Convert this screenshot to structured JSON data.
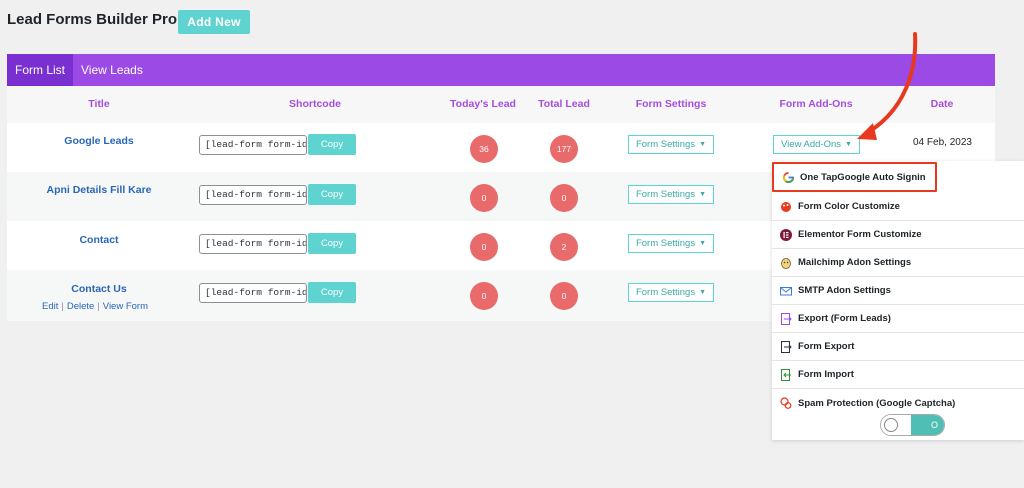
{
  "header": {
    "title": "Lead Forms Builder Pro",
    "add_new_label": "Add New"
  },
  "tabs": [
    {
      "label": "Form List",
      "active": true
    },
    {
      "label": "View Leads",
      "active": false
    }
  ],
  "columns": {
    "title": "Title",
    "shortcode": "Shortcode",
    "todays_lead": "Today's Lead",
    "total_lead": "Total Lead",
    "form_settings": "Form Settings",
    "form_addons": "Form Add-Ons",
    "date": "Date"
  },
  "rows": [
    {
      "title": "Google Leads",
      "shortcode": "[lead-form form-id=",
      "copy": "Copy",
      "todays": "36",
      "total": "177",
      "settings": "Form Settings",
      "addons": "View Add-Ons",
      "date": "04 Feb, 2023"
    },
    {
      "title": "Apni Details Fill Kare",
      "shortcode": "[lead-form form-id=",
      "copy": "Copy",
      "todays": "0",
      "total": "0",
      "settings": "Form Settings"
    },
    {
      "title": "Contact",
      "shortcode": "[lead-form form-id=",
      "copy": "Copy",
      "todays": "0",
      "total": "2",
      "settings": "Form Settings"
    },
    {
      "title": "Contact Us",
      "shortcode": "[lead-form form-id=",
      "copy": "Copy",
      "todays": "0",
      "total": "0",
      "settings": "Form Settings",
      "actions": {
        "edit": "Edit",
        "delete": "Delete",
        "view": "View Form",
        "separator": "|"
      }
    }
  ],
  "dropdown": {
    "items": [
      {
        "label": "One TapGoogle Auto Signin",
        "icon": "google-icon",
        "highlighted": true
      },
      {
        "label": "Form Color Customize",
        "icon": "palette-icon"
      },
      {
        "label": "Elementor Form Customize",
        "icon": "elementor-icon"
      },
      {
        "label": "Mailchimp Adon Settings",
        "icon": "mailchimp-icon"
      },
      {
        "label": "SMTP Adon Settings",
        "icon": "mail-icon"
      },
      {
        "label": "Export (Form Leads)",
        "icon": "export-icon"
      },
      {
        "label": "Form Export",
        "icon": "form-export-icon"
      },
      {
        "label": "Form Import",
        "icon": "form-import-icon"
      },
      {
        "label": "Spam Protection (Google Captcha)",
        "icon": "spam-protection-icon"
      }
    ],
    "toggle_on_symbol": "O"
  },
  "colors": {
    "accent_purple": "#9b4ae6",
    "teal": "#5fd3cf",
    "badge_red": "#e96a6a",
    "arrow_red": "#e8391f",
    "link_blue": "#2a66b8"
  }
}
